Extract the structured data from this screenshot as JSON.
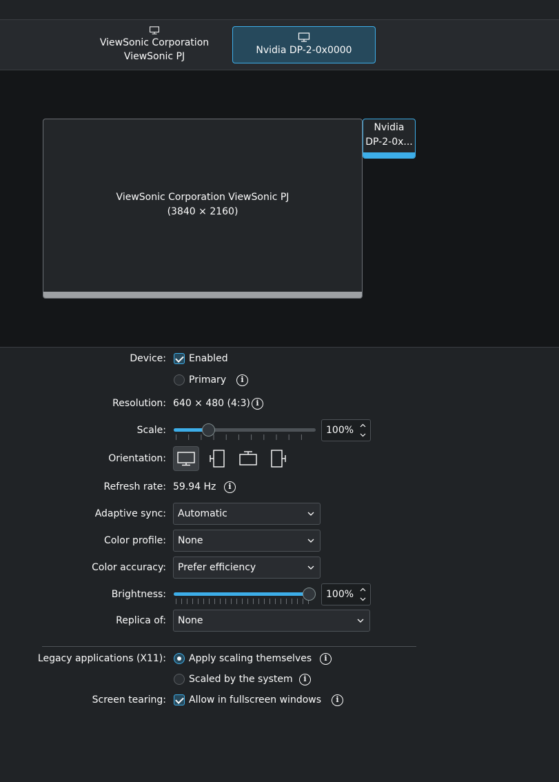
{
  "tabs": [
    {
      "line1": "ViewSonic Corporation",
      "line2": "ViewSonic PJ",
      "icon": "monitor-icon",
      "selected": false
    },
    {
      "line1": "Nvidia DP-2-0x0000",
      "icon": "monitor-icon",
      "selected": true
    }
  ],
  "outputs": {
    "big": {
      "name": "ViewSonic Corporation ViewSonic PJ",
      "size": "(3840 × 2160)"
    },
    "small": {
      "line1": "Nvidia",
      "line2": "DP-2-0x..."
    }
  },
  "form": {
    "device": {
      "label": "Device:",
      "enabled_label": "Enabled",
      "enabled": true,
      "primary_label": "Primary",
      "primary": false
    },
    "resolution": {
      "label": "Resolution:",
      "value": "640 × 480 (4:3)"
    },
    "scale": {
      "label": "Scale:",
      "value": "100%",
      "level": 0.22
    },
    "orientation": {
      "label": "Orientation:",
      "options": [
        "landscape-icon",
        "portrait-left-icon",
        "landscape-flipped-icon",
        "portrait-right-icon"
      ],
      "selected": 0
    },
    "refresh": {
      "label": "Refresh rate:",
      "value": "59.94 Hz"
    },
    "adaptive_sync": {
      "label": "Adaptive sync:",
      "value": "Automatic"
    },
    "color_profile": {
      "label": "Color profile:",
      "value": "None"
    },
    "color_accuracy": {
      "label": "Color accuracy:",
      "value": "Prefer efficiency"
    },
    "brightness": {
      "label": "Brightness:",
      "value": "100%",
      "level": 1.0
    },
    "replica": {
      "label": "Replica of:",
      "value": "None"
    },
    "legacy": {
      "label": "Legacy applications (X11):",
      "option1": "Apply scaling themselves",
      "option2": "Scaled by the system",
      "selected": 0
    },
    "tearing": {
      "label": "Screen tearing:",
      "option": "Allow in fullscreen windows",
      "checked": true
    }
  },
  "colors": {
    "accent": "#3daee9",
    "background": "#202326",
    "canvas": "#141618"
  }
}
